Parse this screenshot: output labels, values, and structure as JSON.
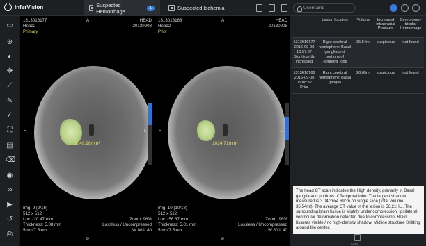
{
  "app": {
    "logo_text": "InferVision"
  },
  "tabs": [
    {
      "label": "Suspected Hemorrhage",
      "badge": "1"
    },
    {
      "label": "Suspected Ischemia"
    }
  ],
  "user": {
    "placeholder": "Username"
  },
  "left_view": {
    "tl": [
      "1313016177",
      "Head2",
      "Primary"
    ],
    "tr": [
      "HEAD",
      "20130908"
    ],
    "top_marker": "A",
    "bl": [
      "Img: 9 (9/16)",
      "512 x 512",
      "Loc: -20.47 mm",
      "Thickness: 5.08 mm",
      "5mm/7.5mm"
    ],
    "br": [
      "Zoom: 96%",
      "Lossless / Uncompressed",
      "W 80 L 40"
    ],
    "bottom_marker": "P",
    "left_marker": "R",
    "right_marker": "L",
    "measure": "1049.98mm²"
  },
  "right_view": {
    "tl": [
      "1313016168",
      "Head2",
      "Prior"
    ],
    "tr": [
      "HEAD",
      "20130908"
    ],
    "top_marker": "A",
    "bl": [
      "Img: 10 (10/18)",
      "512 x 512",
      "Loc: -56.37 mm",
      "Thickness: 5.01 mm",
      "5mm/7.5mm"
    ],
    "br": [
      "Zoom: 96%",
      "Lossless / Uncompressed",
      "W 80 L 40"
    ],
    "bottom_marker": "P",
    "left_marker": "R",
    "right_marker": "L",
    "measure": "1024.71mm²"
  },
  "table": {
    "headers": [
      "",
      "Lesion location",
      "Volume",
      "Increased intracranial Pressure",
      "Cerebroven-tricular Hemorrhage"
    ],
    "rows": [
      {
        "id": "1313016177",
        "date": "2016-09-08",
        "time": "10:57:37",
        "status1": "Significantly",
        "status2": "increased",
        "location": "Right cerebral hemisphere: Basal ganglia and portions of Temporal lobe",
        "volume": "35.54ml",
        "pressure": "suspicious",
        "hemorrhage": "not found"
      },
      {
        "id": "1313016168",
        "date": "2016-09-08",
        "time": "06:08:32",
        "status1": "Prior",
        "status2": "",
        "location": "Right cerebral hemisphere: Basal ganglia",
        "volume": "26.69ml",
        "pressure": "suspicious",
        "hemorrhage": "not found"
      }
    ]
  },
  "report": "The head CT scan indicates the High density, primarily in Basal ganglia and portions of Temporal lobe. The largest shadow measured is 3.04cmx4.69cm on single slice (total volume: 35.54ml). The average CT value in the lesion is 56.21HU. The surrounding brain tissue is slightly under compression, Ipsilateral ventricular deformation detected due to compression. Brain fissures visible / no high-density shadow, Midline structure Shifting around the center.",
  "bottom": {
    "label": "Copy"
  },
  "colors": {
    "accent": "#2f73d6",
    "measure": "#e8e060",
    "lesion": "#b8d28a"
  }
}
